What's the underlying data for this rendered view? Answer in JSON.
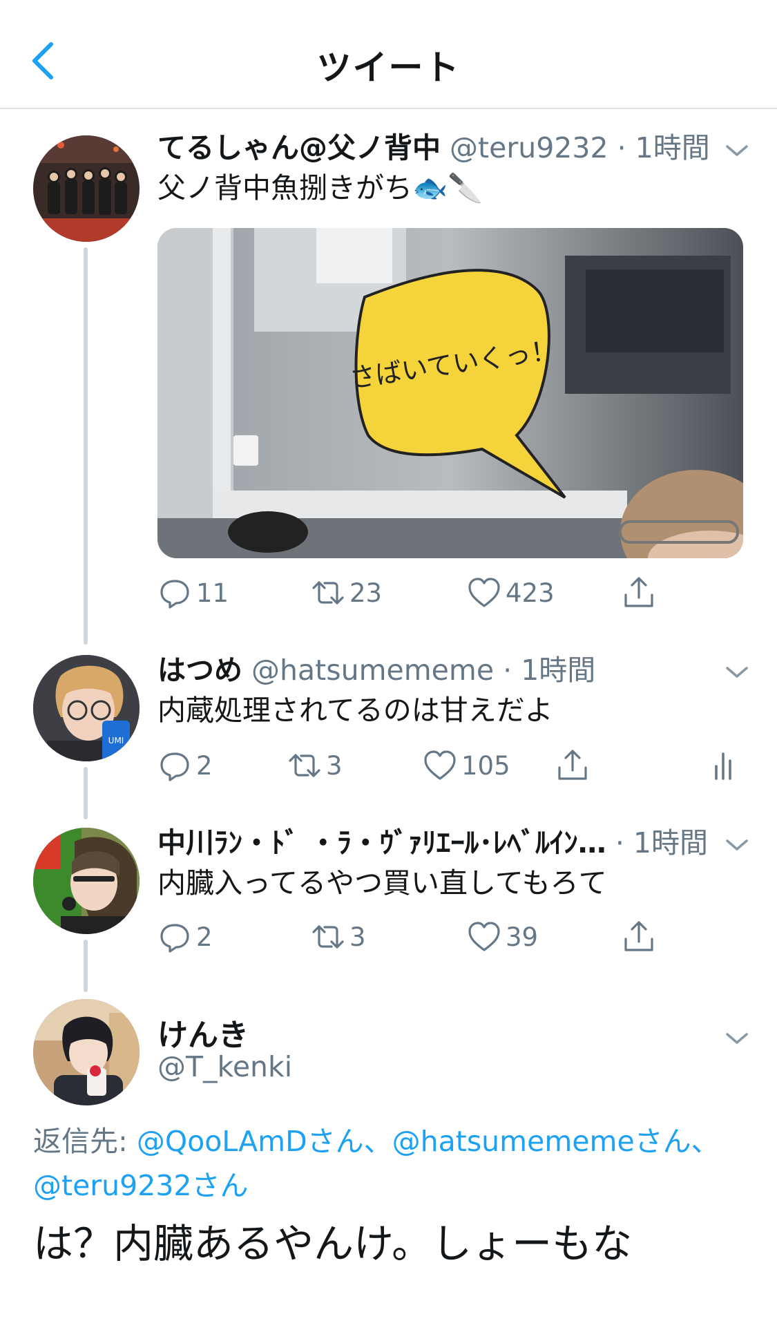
{
  "colors": {
    "accent": "#1da1f2",
    "secondary_text": "#657786",
    "thread_line": "#cdd6dd"
  },
  "header": {
    "title": "ツイート",
    "back_icon": "chevron-left-icon"
  },
  "tweets": [
    {
      "name": "てるしゃん@父ノ背中",
      "handle": "@teru9232",
      "dot": "·",
      "time": "1時間",
      "text": "父ノ背中魚捌きがち🐟🔪",
      "media": {
        "caption_bubble": "さばいていくっ！"
      },
      "replies": "11",
      "retweets": "23",
      "likes": "423"
    },
    {
      "name": "はつめ",
      "handle": "@hatsumememe",
      "dot": "·",
      "time": "1時間",
      "text": "内蔵処理されてるのは甘えだよ",
      "replies": "2",
      "retweets": "3",
      "likes": "105"
    },
    {
      "name": "中川ﾗﾝ・ﾄﾞ ・ﾗ・ｳﾞｧﾘｴｰﾙ･ﾚﾍﾞﾙｲﾝ…",
      "dot": "·",
      "time": "1時間",
      "text": "内臓入ってるやつ買い直してもろて",
      "replies": "2",
      "retweets": "3",
      "likes": "39"
    }
  ],
  "focused": {
    "name": "けんき",
    "handle": "@T_kenki",
    "reply_label": "返信先: ",
    "reply_mentions": [
      "@QooLAmDさん",
      "、",
      "@hatsumememeさん",
      "、",
      "@teru9232さん"
    ],
    "text": "は？内臓あるやんけ。しょーもな"
  }
}
